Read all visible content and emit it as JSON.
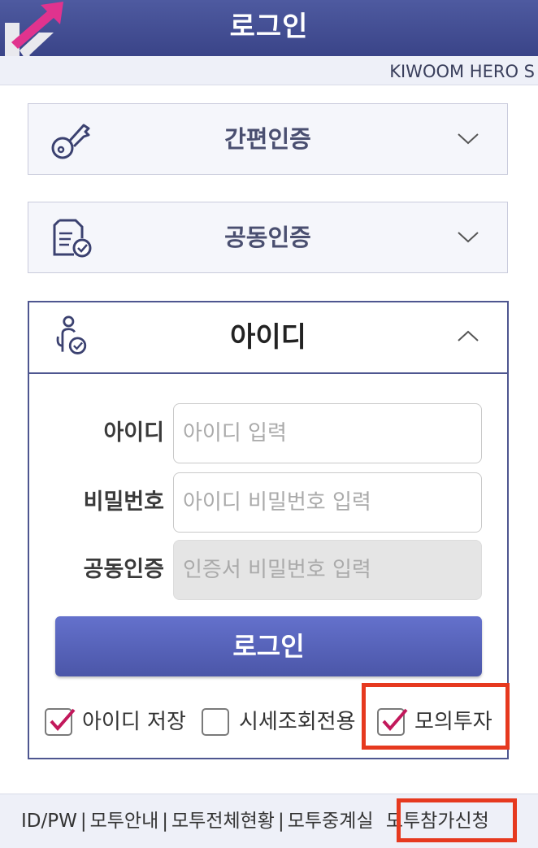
{
  "header": {
    "title": "로그인",
    "brand": "KIWOOM HERO S"
  },
  "panels": {
    "easy_auth": {
      "label": "간편인증",
      "icon": "key-icon"
    },
    "joint_cert": {
      "label": "공동인증",
      "icon": "certificate-icon"
    },
    "id_login": {
      "label": "아이디",
      "icon": "person-check-icon",
      "expanded": true
    }
  },
  "form": {
    "id_label": "아이디",
    "id_placeholder": "아이디 입력",
    "pw_label": "비밀번호",
    "pw_placeholder": "아이디 비밀번호 입력",
    "cert_label": "공동인증",
    "cert_placeholder": "인증서 비밀번호 입력",
    "login_button": "로그인"
  },
  "options": {
    "save_id": {
      "label": "아이디 저장",
      "checked": true
    },
    "quote_only": {
      "label": "시세조회전용",
      "checked": false
    },
    "mock_invest": {
      "label": "모의투자",
      "checked": true
    }
  },
  "footer": {
    "links": [
      "ID/PW",
      "모투안내",
      "모투전체현황",
      "모투중계실",
      "모투참가신청"
    ]
  },
  "colors": {
    "header_bg": "#3a4488",
    "accent": "#4b56a8",
    "check": "#c2185b",
    "highlight_box": "#e6391f"
  }
}
